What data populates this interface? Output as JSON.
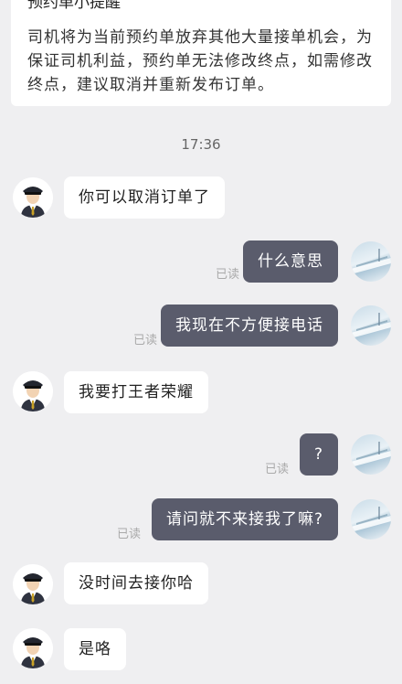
{
  "notice": {
    "title": "预约单小提醒",
    "body": "司机将为当前预约单放弃其他大量接单机会，为保证司机利益，预约单无法修改终点，如需修改终点，建议取消并重新发布订单。"
  },
  "timestamp": "17:36",
  "read_label": "已读",
  "messages": [
    {
      "from": "driver",
      "text": "你可以取消订单了"
    },
    {
      "from": "user",
      "text": "什么意思"
    },
    {
      "from": "user",
      "text": "我现在不方便接电话"
    },
    {
      "from": "driver",
      "text": "我要打王者荣耀"
    },
    {
      "from": "user",
      "text": "?"
    },
    {
      "from": "user",
      "text": "请问就不来接我了嘛?"
    },
    {
      "from": "driver",
      "text": "没时间去接你哈"
    },
    {
      "from": "driver",
      "text": "是咯"
    }
  ],
  "icons": {
    "driver_avatar": "driver-avatar-icon",
    "user_avatar": "user-avatar-icon"
  },
  "colors": {
    "background": "#efeff1",
    "incoming_bubble": "#ffffff",
    "outgoing_bubble": "#5a5c6c",
    "read_text": "#aaaaaa"
  }
}
